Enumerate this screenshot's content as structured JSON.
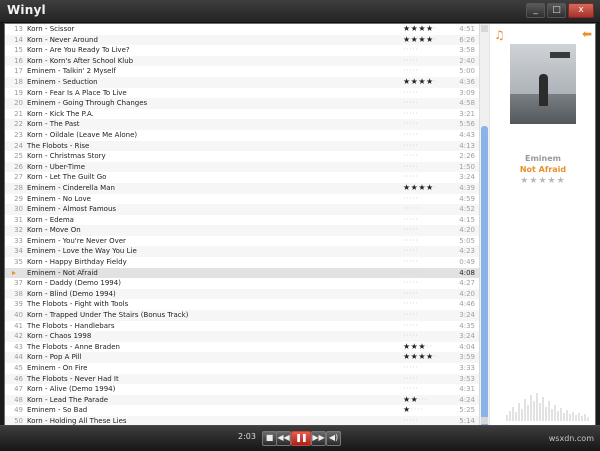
{
  "window": {
    "title": "Winyl",
    "minimize": "_",
    "maximize": "□",
    "close": "x"
  },
  "playlist": {
    "rows": [
      {
        "n": "13",
        "title": "Korn - Scissor",
        "rating": 4,
        "duration": "4:51"
      },
      {
        "n": "14",
        "title": "Korn - Never Around",
        "rating": 4,
        "duration": "6:26"
      },
      {
        "n": "15",
        "title": "Korn - Are You Ready To Live?",
        "rating": 0,
        "duration": "3:58"
      },
      {
        "n": "16",
        "title": "Korn - Korn's After School Klub",
        "rating": 0,
        "duration": "2:40"
      },
      {
        "n": "17",
        "title": "Eminem - Talkin' 2 Myself",
        "rating": 0,
        "duration": "5:00"
      },
      {
        "n": "18",
        "title": "Eminem - Seduction",
        "rating": 4,
        "duration": "4:36"
      },
      {
        "n": "19",
        "title": "Korn - Fear Is A Place To Live",
        "rating": 0,
        "duration": "3:09"
      },
      {
        "n": "20",
        "title": "Eminem - Going Through Changes",
        "rating": 0,
        "duration": "4:58"
      },
      {
        "n": "21",
        "title": "Korn - Kick The P.A.",
        "rating": 0,
        "duration": "3:21"
      },
      {
        "n": "22",
        "title": "Korn - The Past",
        "rating": 0,
        "duration": "5:56"
      },
      {
        "n": "23",
        "title": "Korn - Oildale (Leave Me Alone)",
        "rating": 0,
        "duration": "4:43"
      },
      {
        "n": "24",
        "title": "The Flobots - Rise",
        "rating": 0,
        "duration": "4:13"
      },
      {
        "n": "25",
        "title": "Korn - Christmas Story",
        "rating": 0,
        "duration": "2:26"
      },
      {
        "n": "26",
        "title": "Korn - Uber-Time",
        "rating": 0,
        "duration": "1:50"
      },
      {
        "n": "27",
        "title": "Korn - Let The Guilt Go",
        "rating": 0,
        "duration": "3:24"
      },
      {
        "n": "28",
        "title": "Eminem - Cinderella Man",
        "rating": 4,
        "duration": "4:39"
      },
      {
        "n": "29",
        "title": "Eminem - No Love",
        "rating": 0,
        "duration": "4:59"
      },
      {
        "n": "30",
        "title": "Eminem - Almost Famous",
        "rating": 0,
        "duration": "4:52"
      },
      {
        "n": "31",
        "title": "Korn - Edema",
        "rating": 0,
        "duration": "4:15"
      },
      {
        "n": "32",
        "title": "Korn - Move On",
        "rating": 0,
        "duration": "4:20"
      },
      {
        "n": "33",
        "title": "Eminem - You're Never Over",
        "rating": 0,
        "duration": "5:05"
      },
      {
        "n": "34",
        "title": "Eminem - Love the Way You Lie",
        "rating": 0,
        "duration": "4:23"
      },
      {
        "n": "35",
        "title": "Korn - Happy Birthday Fieldy",
        "rating": 0,
        "duration": "0:49"
      },
      {
        "n": "36",
        "title": "Eminem - Not Afraid",
        "rating": 0,
        "duration": "4:08",
        "playing": true
      },
      {
        "n": "37",
        "title": "Korn - Daddy (Demo 1994)",
        "rating": 0,
        "duration": "4:27"
      },
      {
        "n": "38",
        "title": "Korn - Blind (Demo 1994)",
        "rating": 0,
        "duration": "4:20"
      },
      {
        "n": "39",
        "title": "The Flobots - Fight with Tools",
        "rating": 0,
        "duration": "4:46"
      },
      {
        "n": "40",
        "title": "Korn - Trapped Under The Stairs (Bonus Track)",
        "rating": 0,
        "duration": "3:24"
      },
      {
        "n": "41",
        "title": "The Flobots - Handlebars",
        "rating": 0,
        "duration": "4:35"
      },
      {
        "n": "42",
        "title": "Korn - Chaos 1998",
        "rating": 0,
        "duration": "3:24"
      },
      {
        "n": "43",
        "title": "The Flobots - Anne Braden",
        "rating": 3,
        "duration": "4:04"
      },
      {
        "n": "44",
        "title": "Korn - Pop A Pill",
        "rating": 4,
        "duration": "3:59"
      },
      {
        "n": "45",
        "title": "Eminem - On Fire",
        "rating": 0,
        "duration": "3:33"
      },
      {
        "n": "46",
        "title": "The Flobots - Never Had It",
        "rating": 0,
        "duration": "3:53"
      },
      {
        "n": "47",
        "title": "Korn - Alive (Demo 1994)",
        "rating": 0,
        "duration": "4:31"
      },
      {
        "n": "48",
        "title": "Korn - Lead The Parade",
        "rating": 2,
        "duration": "4:24"
      },
      {
        "n": "49",
        "title": "Eminem - So Bad",
        "rating": 1,
        "duration": "5:25"
      },
      {
        "n": "50",
        "title": "Korn - Holding All These Lies",
        "rating": 0,
        "duration": "5:14"
      }
    ]
  },
  "now_playing": {
    "artist": "Eminem",
    "track": "Not Afraid",
    "rating": 0,
    "accent_color": "#e8902c"
  },
  "controls": {
    "time": "2:03",
    "stop": "■",
    "prev": "◀◀",
    "pause": "❚❚",
    "next": "▶▶",
    "volume": "◀)"
  },
  "watermark": "wsxdn.com"
}
